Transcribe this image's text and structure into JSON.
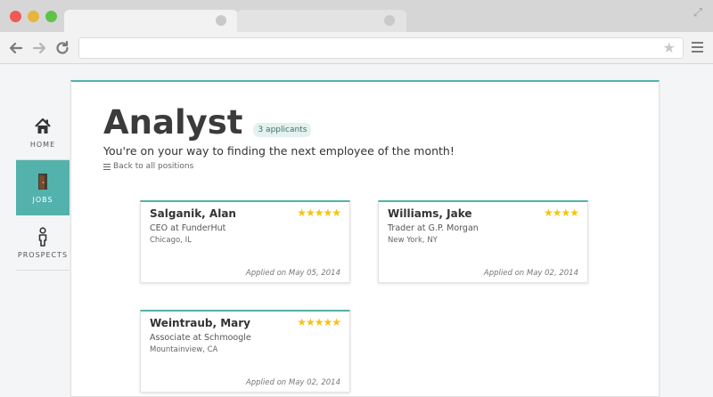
{
  "browser": {
    "url": "",
    "icons": [
      "back-arrow-icon",
      "forward-arrow-icon",
      "reload-icon",
      "bookmark-star-icon",
      "menu-icon",
      "expand-icon"
    ]
  },
  "sidebar": {
    "items": [
      {
        "label": "Home",
        "icon": "home-icon"
      },
      {
        "label": "Jobs",
        "icon": "door-icon",
        "active": true
      },
      {
        "label": "Prospects",
        "icon": "person-icon"
      }
    ]
  },
  "main": {
    "title": "Analyst",
    "badge": "3 applicants",
    "subtitle": "You're on your way to finding the next employee of the month!",
    "back_link": "Back to all positions"
  },
  "applicants": [
    {
      "name": "Salganik, Alan",
      "rating": 5,
      "stars": "★★★★★",
      "role": "CEO at FunderHut",
      "location": "Chicago, IL",
      "applied": "Applied on May 05, 2014"
    },
    {
      "name": "Williams, Jake",
      "rating": 4,
      "stars": "★★★★",
      "role": "Trader at G.P. Morgan",
      "location": "New York, NY",
      "applied": "Applied on May 02, 2014"
    },
    {
      "name": "Weintraub, Mary",
      "rating": 5,
      "stars": "★★★★★",
      "role": "Associate at Schmoogle",
      "location": "Mountainview, CA",
      "applied": "Applied on May 02, 2014"
    }
  ],
  "colors": {
    "accent": "#53b2ac",
    "star": "#f3c417",
    "badge_bg": "#e3f1ef"
  }
}
